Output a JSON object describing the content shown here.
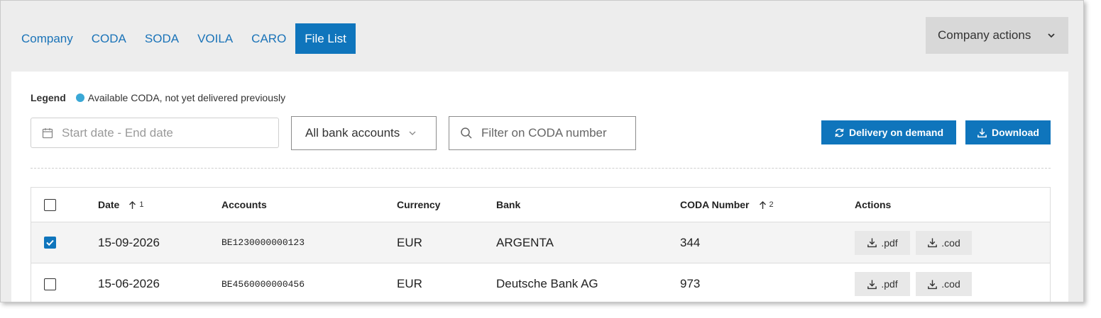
{
  "tabs": [
    {
      "label": "Company",
      "active": false
    },
    {
      "label": "CODA",
      "active": false
    },
    {
      "label": "SODA",
      "active": false
    },
    {
      "label": "VOILA",
      "active": false
    },
    {
      "label": "CARO",
      "active": false
    },
    {
      "label": "File List",
      "active": true
    }
  ],
  "header": {
    "company_actions_label": "Company actions",
    "company_actions_icon": "chevron-down-icon"
  },
  "legend": {
    "title": "Legend",
    "items": [
      {
        "label": "Available CODA, not yet delivered previously",
        "color": "#3aa8d6"
      }
    ]
  },
  "filters": {
    "date_range_placeholder": "Start date - End date",
    "bank_accounts_selected": "All bank accounts",
    "coda_search_placeholder": "Filter on CODA number"
  },
  "buttons": {
    "delivery_on_demand": "Delivery on demand",
    "download": "Download"
  },
  "table": {
    "columns": {
      "date": "Date",
      "date_sort_order": "1",
      "accounts": "Accounts",
      "currency": "Currency",
      "bank": "Bank",
      "coda_number": "CODA Number",
      "coda_sort_order": "2",
      "actions": "Actions"
    },
    "rows": [
      {
        "checked": true,
        "date": "15-09-2026",
        "account": "BE1230000000123",
        "currency": "EUR",
        "bank": "ARGENTA",
        "coda_number": "344",
        "pdf_label": ".pdf",
        "cod_label": ".cod"
      },
      {
        "checked": false,
        "date": "15-06-2026",
        "account": "BE4560000000456",
        "currency": "EUR",
        "bank": "Deutsche Bank AG",
        "coda_number": "973",
        "pdf_label": ".pdf",
        "cod_label": ".cod"
      }
    ]
  },
  "colors": {
    "primary": "#0f75bc",
    "tab_text": "#1a73b8",
    "legend_dot": "#3aa8d6"
  }
}
